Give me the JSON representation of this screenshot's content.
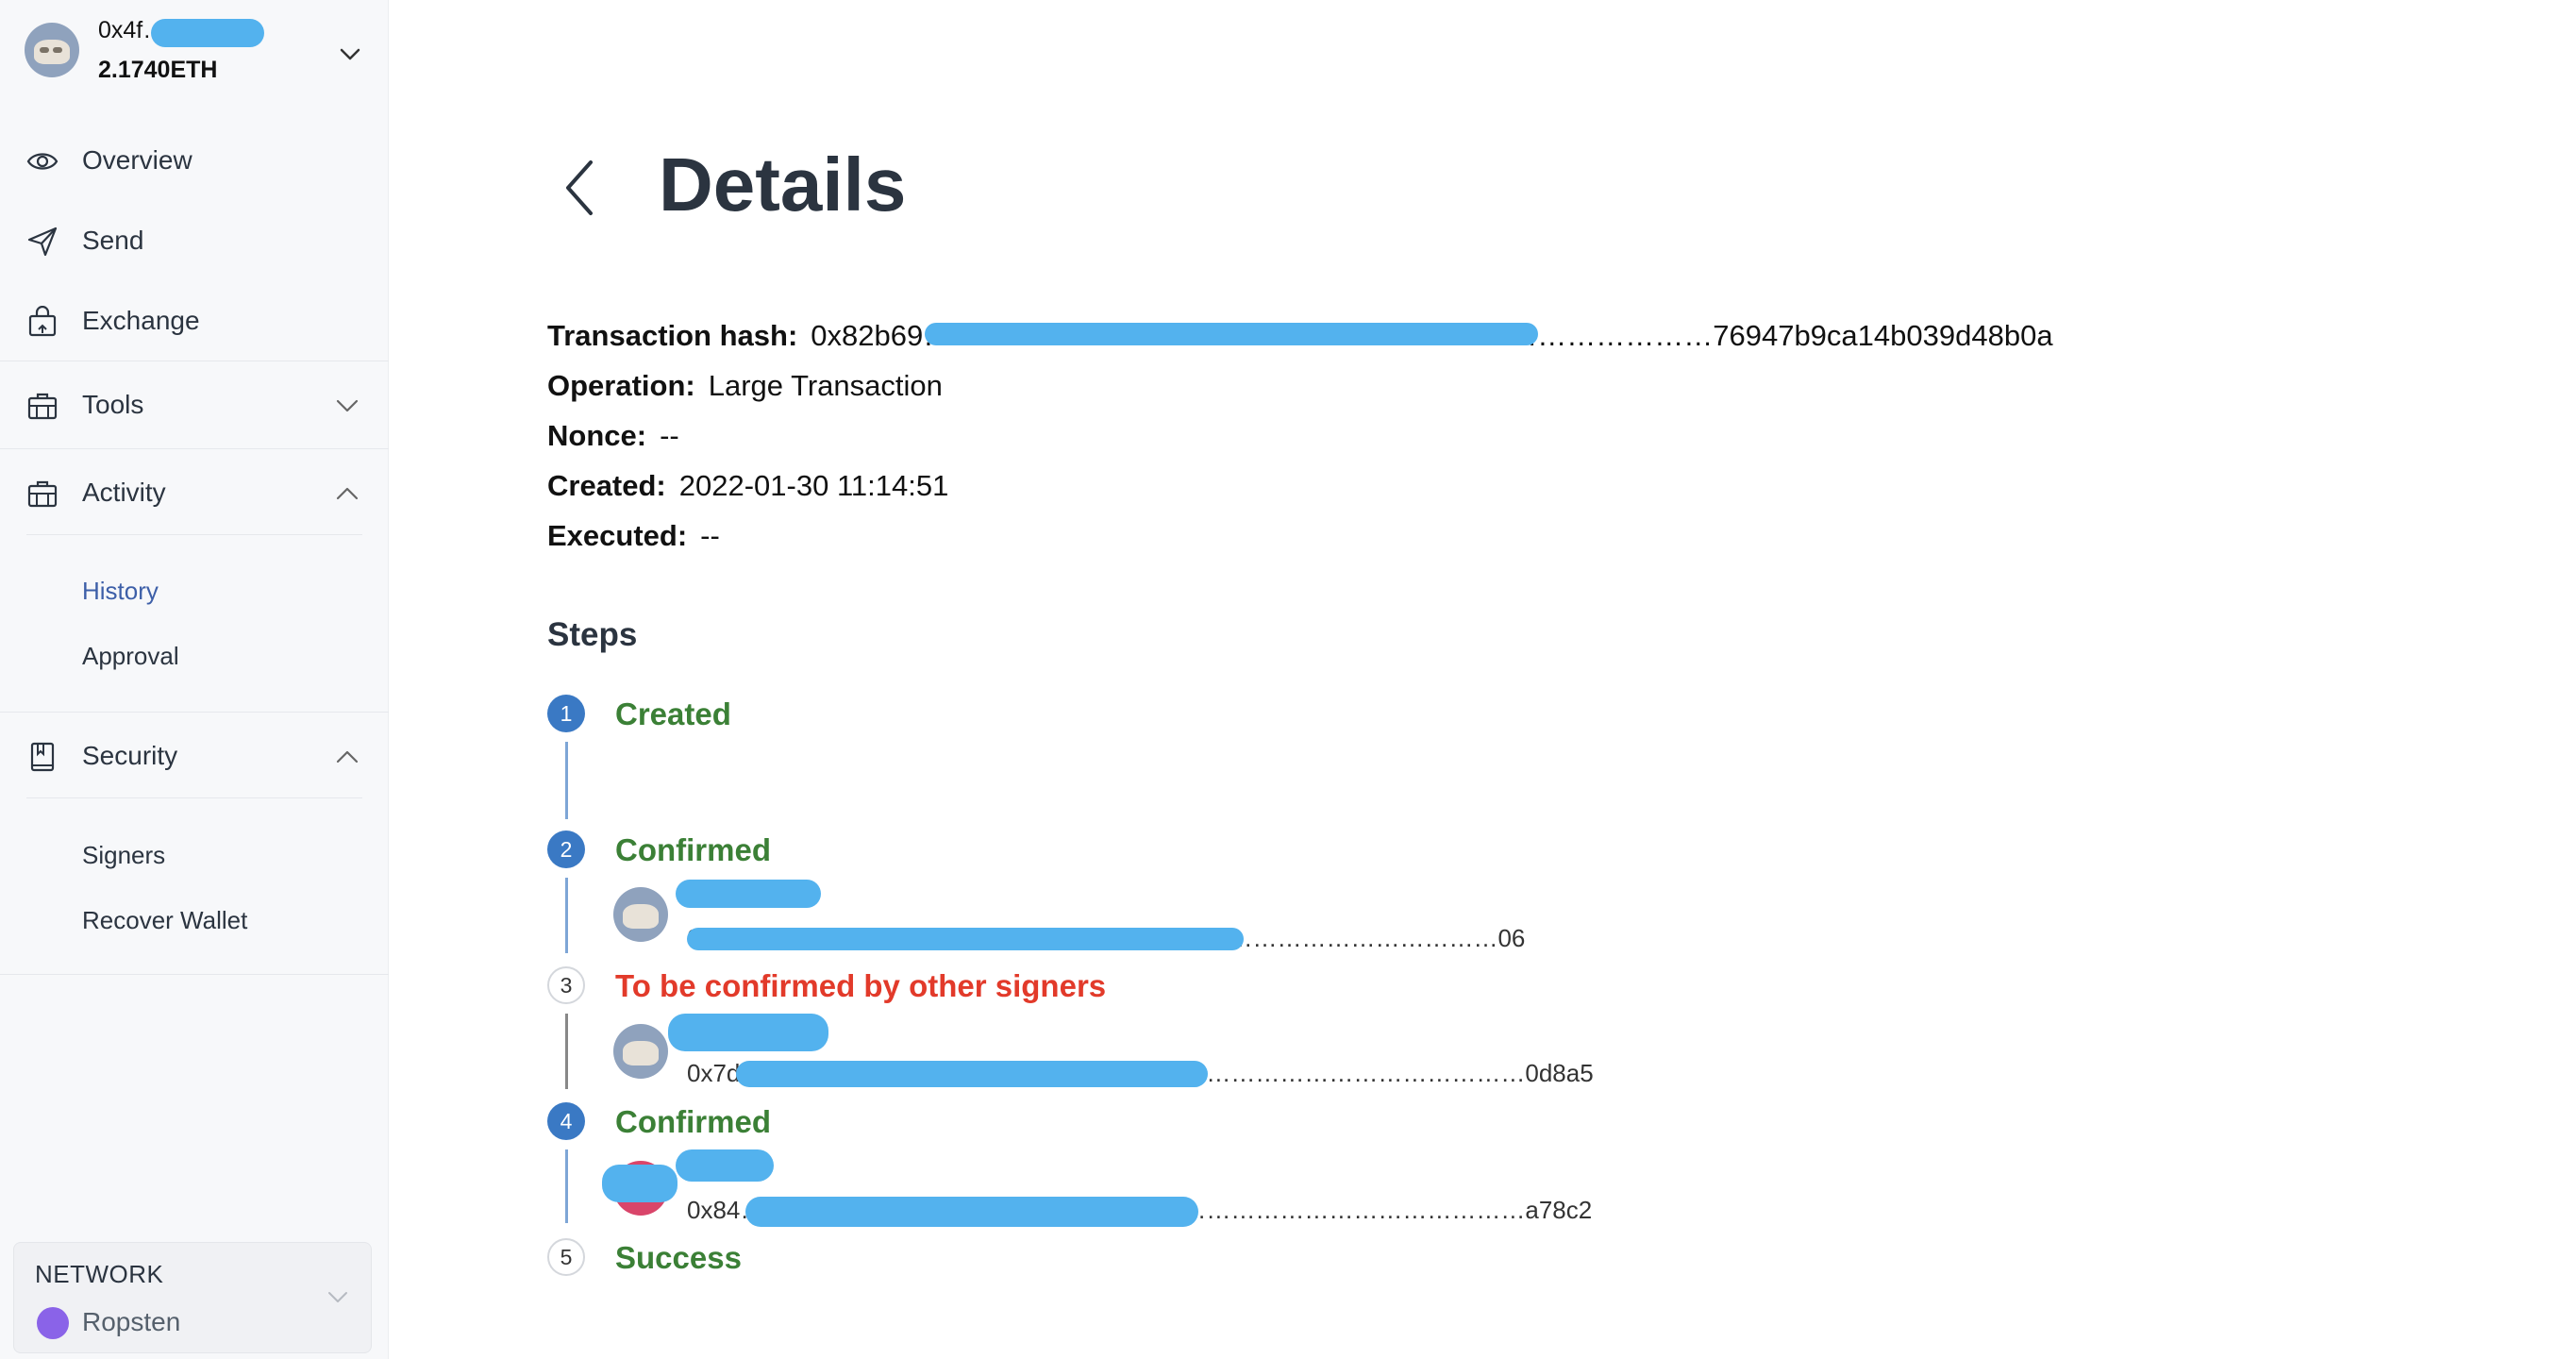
{
  "account": {
    "address": "0x4f………7…",
    "balance": "2.1740ETH"
  },
  "nav": {
    "overview": "Overview",
    "send": "Send",
    "exchange": "Exchange",
    "tools": "Tools",
    "activity": "Activity",
    "activity_items": [
      "History",
      "Approval"
    ],
    "security": "Security",
    "security_items": [
      "Signers",
      "Recover Wallet"
    ]
  },
  "network": {
    "label": "NETWORK",
    "name": "Ropsten"
  },
  "page": {
    "title": "Details"
  },
  "details": {
    "hash_label": "Transaction hash:",
    "hash_value": "0x82b69………………………………………………………………………76947b9ca14b039d48b0a",
    "operation_label": "Operation:",
    "operation_value": "Large Transaction",
    "nonce_label": "Nonce:",
    "nonce_value": "--",
    "created_label": "Created:",
    "created_value": "2022-01-30 11:14:51",
    "executed_label": "Executed:",
    "executed_value": "--"
  },
  "steps": {
    "title": "Steps",
    "items": [
      {
        "num": "1",
        "label": "Created"
      },
      {
        "num": "2",
        "label": "Confirmed",
        "signer_addr": "0x……………………………………………………………………………………06"
      },
      {
        "num": "3",
        "label": "To be confirmed by other signers",
        "signer_addr": "0x7d……………………………………………………………………………………0d8a5"
      },
      {
        "num": "4",
        "label": "Confirmed",
        "signer_addr": "0x84……………………………………………………………………………………a78c2"
      },
      {
        "num": "5",
        "label": "Success"
      }
    ]
  },
  "colors": {
    "confirmed": "#3b8036",
    "pending": "#e23a2a",
    "step_filled": "#3a79c4",
    "active_link": "#3d5fa8",
    "network_dot": "#8a63e8",
    "redaction": "#53b2ee"
  },
  "icons": {
    "overview": "eye-icon",
    "send": "send-arrow-icon",
    "exchange": "bag-icon",
    "tools": "toolbox-icon",
    "activity": "briefcase-icon",
    "security": "book-icon",
    "back": "chevron-left-icon"
  }
}
